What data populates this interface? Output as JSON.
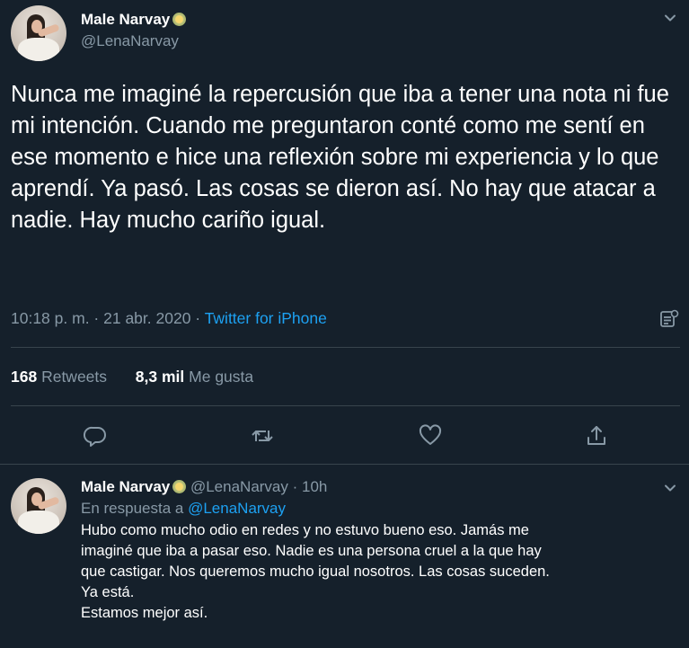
{
  "tweet": {
    "author_name": "Male Narvay",
    "author_handle": "@LenaNarvay",
    "text": "Nunca me imaginé la repercusión que iba a tener una nota ni fue mi intención. Cuando me preguntaron conté como me sentí en ese momento e hice una reflexión sobre mi experiencia y lo que aprendí. Ya pasó. Las cosas se dieron así. No hay que atacar a nadie. Hay mucho cariño igual.",
    "time": "10:18 p. m.",
    "separator": " · ",
    "date": "21 abr. 2020",
    "source": "Twitter for iPhone",
    "retweets_count": "168",
    "retweets_label": "Retweets",
    "likes_count": "8,3 mil",
    "likes_label": "Me gusta"
  },
  "reply": {
    "author_name": "Male Narvay",
    "author_handle": "@LenaNarvay",
    "time_ago": "10h",
    "in_reply_prefix": "En respuesta a",
    "in_reply_mention": "@LenaNarvay",
    "lines": [
      "Hubo como mucho odio en redes y no estuvo bueno eso. Jamás me",
      "imaginé que iba a pasar eso. Nadie es una persona cruel a la que hay",
      "que castigar. Nos queremos mucho igual nosotros. Las cosas suceden.",
      "Ya está.",
      "Estamos mejor así."
    ]
  },
  "icons": {
    "verified_badge": "flower-badge-icon",
    "more": "chevron-down-icon",
    "analytics": "analytics-icon",
    "reply": "reply-icon",
    "retweet": "retweet-icon",
    "like": "heart-icon",
    "share": "share-icon"
  },
  "colors": {
    "background": "#15202b",
    "text": "#ffffff",
    "secondary": "#8899a6",
    "link": "#1da1f2",
    "divider": "#38444d"
  }
}
